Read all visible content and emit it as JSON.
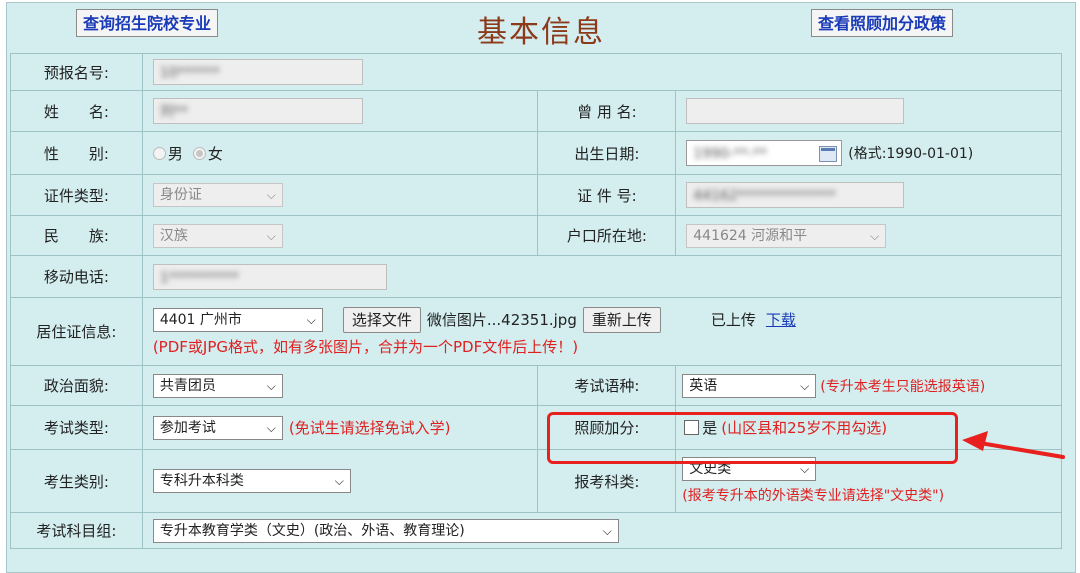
{
  "header": {
    "left_button": "查询招生院校专业",
    "title": "基本信息",
    "right_button": "查看照顾加分政策"
  },
  "fields": {
    "pre_reg_no": {
      "label": "预报名号:",
      "value": "10******"
    },
    "name": {
      "label": "姓　　名:",
      "value": "刘**"
    },
    "former_name": {
      "label": "曾 用 名:",
      "value": ""
    },
    "gender": {
      "label": "性　　别:",
      "options": [
        "男",
        "女"
      ],
      "selected": "女"
    },
    "birth_date": {
      "label": "出生日期:",
      "value": "1990-**-**",
      "hint": "(格式:1990-01-01)"
    },
    "id_type": {
      "label": "证件类型:",
      "value": "身份证"
    },
    "id_no": {
      "label": "证 件 号:",
      "value": "44162**************"
    },
    "ethnicity": {
      "label": "民　　族:",
      "value": "汉族"
    },
    "hukou": {
      "label": "户口所在地:",
      "value": "441624 河源和平"
    },
    "mobile": {
      "label": "移动电话:",
      "value": "1**********"
    },
    "residence_permit": {
      "label": "居住证信息:",
      "city": "4401 广州市",
      "choose_file": "选择文件",
      "file_name": "微信图片...42351.jpg",
      "reupload": "重新上传",
      "status": "已上传",
      "download": "下载",
      "note": "(PDF或JPG格式，如有多张图片，合并为一个PDF文件后上传！)"
    },
    "political": {
      "label": "政治面貌:",
      "value": "共青团员"
    },
    "exam_language": {
      "label": "考试语种:",
      "value": "英语",
      "note": "(专升本考生只能选报英语)"
    },
    "exam_type": {
      "label": "考试类型:",
      "value": "参加考试",
      "note": "(免试生请选择免试入学)"
    },
    "bonus": {
      "label": "照顾加分:",
      "checkbox_label": "是",
      "note": "(山区县和25岁不用勾选)"
    },
    "candidate_category": {
      "label": "考生类别:",
      "value": "专科升本科类"
    },
    "subject_category": {
      "label": "报考科类:",
      "value": "文史类",
      "note": "(报考专升本的外语类专业请选择\"文史类\")"
    },
    "subject_group": {
      "label": "考试科目组:",
      "value": "专升本教育学类（文史）(政治、外语、教育理论)"
    }
  },
  "colors": {
    "background": "#d4eef0",
    "title": "#8b3a1a",
    "link": "#1a3bb8",
    "warning": "#e02020"
  }
}
